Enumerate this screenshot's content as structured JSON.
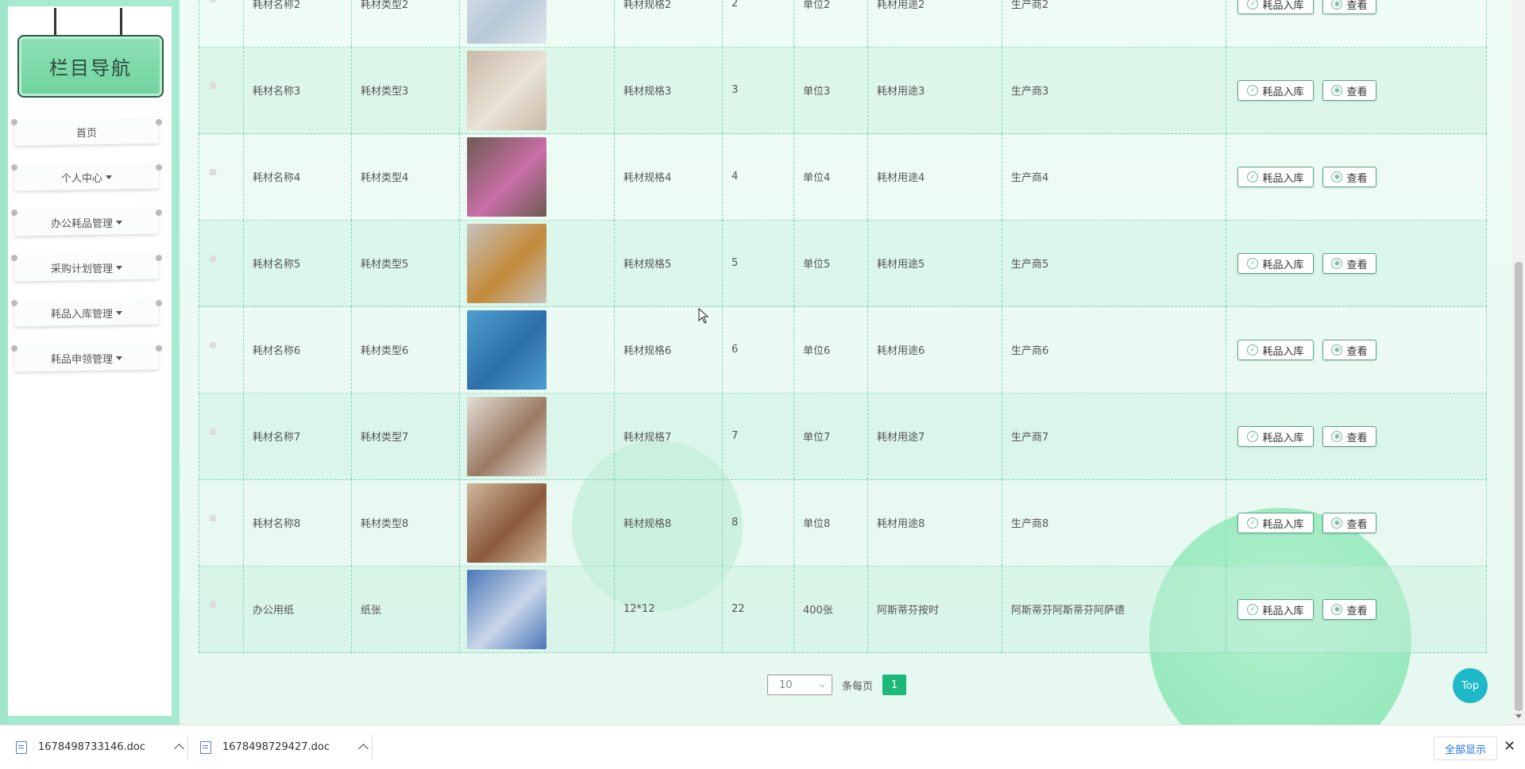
{
  "sidebar": {
    "title": "栏目导航",
    "items": [
      {
        "label": "首页",
        "has_caret": false
      },
      {
        "label": "个人中心",
        "has_caret": true
      },
      {
        "label": "办公耗品管理",
        "has_caret": true
      },
      {
        "label": "采购计划管理",
        "has_caret": true
      },
      {
        "label": "耗品入库管理",
        "has_caret": true
      },
      {
        "label": "耗品申领管理",
        "has_caret": true
      }
    ]
  },
  "table": {
    "rows": [
      {
        "name": "耗材名称2",
        "type": "耗材类型2",
        "spec": "耗材规格2",
        "qty": "2",
        "unit": "单位2",
        "use": "耗材用途2",
        "maker": "生产商2",
        "image_colors": [
          "#dfe6ec",
          "#b8c8d8"
        ]
      },
      {
        "name": "耗材名称3",
        "type": "耗材类型3",
        "spec": "耗材规格3",
        "qty": "3",
        "unit": "单位3",
        "use": "耗材用途3",
        "maker": "生产商3",
        "image_colors": [
          "#c9b9a6",
          "#e9e2d8"
        ]
      },
      {
        "name": "耗材名称4",
        "type": "耗材类型4",
        "spec": "耗材规格4",
        "qty": "4",
        "unit": "单位4",
        "use": "耗材用途4",
        "maker": "生产商4",
        "image_colors": [
          "#6e5a52",
          "#c86fa6"
        ]
      },
      {
        "name": "耗材名称5",
        "type": "耗材类型5",
        "spec": "耗材规格5",
        "qty": "5",
        "unit": "单位5",
        "use": "耗材用途5",
        "maker": "生产商5",
        "image_colors": [
          "#c6c2bc",
          "#c38a3a"
        ]
      },
      {
        "name": "耗材名称6",
        "type": "耗材类型6",
        "spec": "耗材规格6",
        "qty": "6",
        "unit": "单位6",
        "use": "耗材用途6",
        "maker": "生产商6",
        "image_colors": [
          "#4f9fd0",
          "#2c6fa8"
        ]
      },
      {
        "name": "耗材名称7",
        "type": "耗材类型7",
        "spec": "耗材规格7",
        "qty": "7",
        "unit": "单位7",
        "use": "耗材用途7",
        "maker": "生产商7",
        "image_colors": [
          "#e3ddd6",
          "#9a7a63"
        ]
      },
      {
        "name": "耗材名称8",
        "type": "耗材类型8",
        "spec": "耗材规格8",
        "qty": "8",
        "unit": "单位8",
        "use": "耗材用途8",
        "maker": "生产商8",
        "image_colors": [
          "#d0b89c",
          "#8c5a3c"
        ]
      },
      {
        "name": "办公用纸",
        "type": "纸张",
        "spec": "12*12",
        "qty": "22",
        "unit": "400张",
        "use": "阿斯蒂芬按时",
        "maker": "阿斯蒂芬阿斯蒂芬阿萨德",
        "image_colors": [
          "#4a76b8",
          "#c9d6e8"
        ]
      }
    ],
    "actions": {
      "stock_in": "耗品入库",
      "view": "查看"
    }
  },
  "pagination": {
    "page_size": "10",
    "per_page_label": "条每页",
    "current_page": "1"
  },
  "top_button": "Top",
  "downloads": {
    "files": [
      "1678498733146.doc",
      "1678498729427.doc"
    ],
    "show_all": "全部显示"
  },
  "colors": {
    "accent": "#1db97a",
    "sidebar_bg": "#a6ead0",
    "row_border": "#7fd5b0",
    "top_button": "#1fb8c8"
  }
}
